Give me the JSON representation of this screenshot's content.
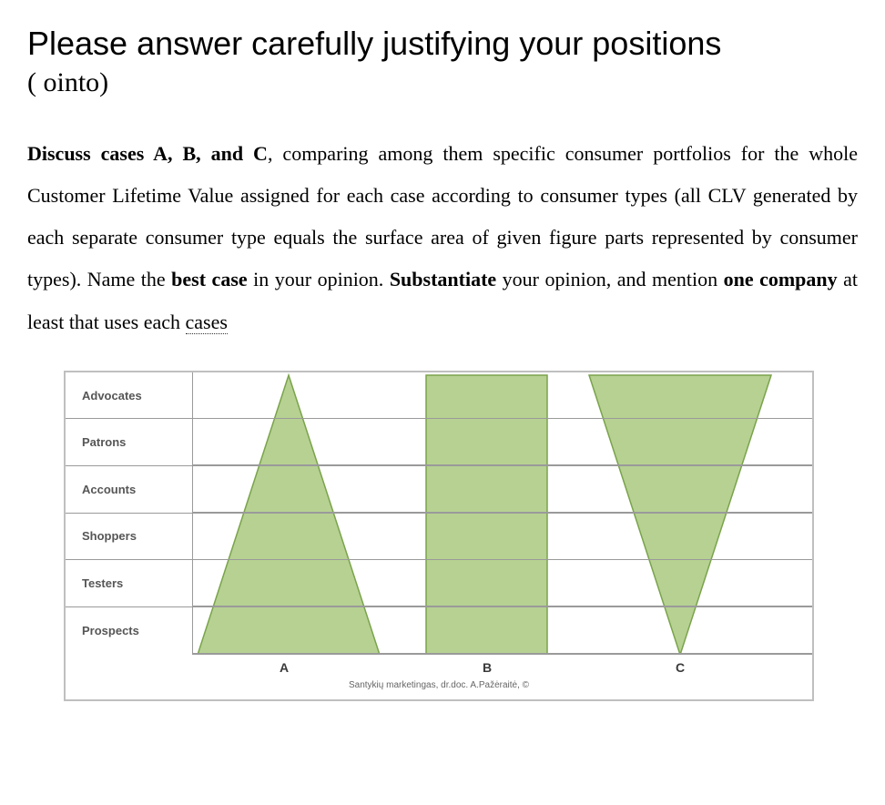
{
  "header": "Please answer carefully justifying your positions",
  "fragment": "(        ointo)",
  "instruction_parts": {
    "p1a": "Discuss cases A, B, and C",
    "p1b": ", comparing among them specific consumer portfolios for the whole Customer Lifetime Value assigned for each case according to consumer types (all CLV generated by each separate consumer type equals the surface area of given figure parts represented by consumer types). Name the ",
    "p1c": "best case",
    "p1d": " in your opinion. ",
    "p2a": "Substantiate",
    "p2b": " your opinion, and mention ",
    "p2c": "one company",
    "p2d": " at least that uses each ",
    "p2e": "cases"
  },
  "chart_data": {
    "type": "area",
    "row_labels": [
      "Advocates",
      "Patrons",
      "Accounts",
      "Shoppers",
      "Testers",
      "Prospects"
    ],
    "col_labels": [
      "A",
      "B",
      "C"
    ],
    "attribution": "Santykių marketingas, dr.doc. A.Pažėraitė, ©",
    "series": [
      {
        "name": "A",
        "shape": "triangle-up",
        "values_by_row": {
          "Advocates": 0.02,
          "Patrons": 0.1,
          "Accounts": 0.3,
          "Shoppers": 0.6,
          "Testers": 0.95,
          "Prospects": 1.3
        }
      },
      {
        "name": "B",
        "shape": "rectangle",
        "values_by_row": {
          "Advocates": 1.0,
          "Patrons": 1.0,
          "Accounts": 1.0,
          "Shoppers": 1.0,
          "Testers": 1.0,
          "Prospects": 1.0
        }
      },
      {
        "name": "C",
        "shape": "triangle-down",
        "values_by_row": {
          "Advocates": 1.3,
          "Patrons": 0.95,
          "Accounts": 0.6,
          "Shoppers": 0.3,
          "Testers": 0.1,
          "Prospects": 0.02
        }
      }
    ]
  }
}
